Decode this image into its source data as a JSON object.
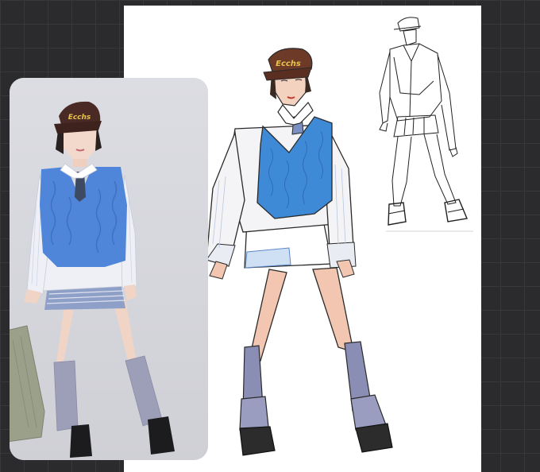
{
  "canvas": {
    "background_color": "#2b2b2d",
    "sheet_color": "#ffffff"
  },
  "reference_photo": {
    "icon": "model-photo-icon",
    "hat_text": "Ecchs",
    "colors": {
      "backdrop": "#d7d8dd",
      "vest": "#4f86da",
      "cap": "#4a2a24",
      "socks": "#9d9fb8",
      "shirt": "#eef0f6",
      "shorts_stripe": "#8ea0c8",
      "bag": "#9aa08a"
    }
  },
  "color_sketch": {
    "icon": "fashion-illustration-icon",
    "hat_text": "Ecchs",
    "colors": {
      "vest": "#3f8ad7",
      "cap": "#6e3a28",
      "socks": "#8a8db4",
      "shoes": "#2c2c2c",
      "skin": "#f2c6b0",
      "line": "#2a2a2a"
    }
  },
  "line_sketch": {
    "icon": "pencil-sketch-icon"
  }
}
